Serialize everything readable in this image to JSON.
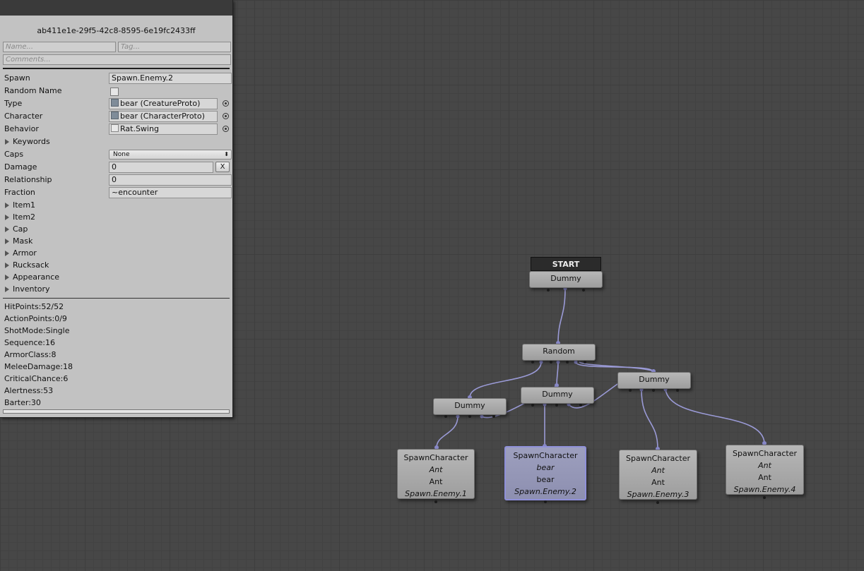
{
  "inspector": {
    "guid": "ab411e1e-29f5-42c8-8595-6e19fc2433ff",
    "name_placeholder": "Name...",
    "tag_placeholder": "Tag...",
    "comments_placeholder": "Comments...",
    "fields": {
      "spawn_label": "Spawn",
      "spawn_value": "Spawn.Enemy.2",
      "random_name_label": "Random Name",
      "type_label": "Type",
      "type_value": "bear (CreatureProto)",
      "character_label": "Character",
      "character_value": "bear (CharacterProto)",
      "behavior_label": "Behavior",
      "behavior_value": "Rat.Swing",
      "keywords_label": "Keywords",
      "caps_label": "Caps",
      "caps_value": "None",
      "damage_label": "Damage",
      "damage_value": "0",
      "clear_label": "X",
      "relationship_label": "Relationship",
      "relationship_value": "0",
      "fraction_label": "Fraction",
      "fraction_value": "~encounter"
    },
    "foldouts": [
      "Item1",
      "Item2",
      "Cap",
      "Mask",
      "Armor",
      "Rucksack",
      "Appearance",
      "Inventory"
    ],
    "stats": [
      "HitPoints:52/52",
      "ActionPoints:0/9",
      "ShotMode:Single",
      "Sequence:16",
      "ArmorClass:8",
      "MeleeDamage:18",
      "CriticalChance:6",
      "Alertness:53",
      "Barter:30"
    ]
  },
  "graph": {
    "start_label": "START",
    "dummy_label": "Dummy",
    "random_label": "Random",
    "spawn_nodes": [
      {
        "title": "SpawnCharacter",
        "type": "Ant",
        "character": "Ant",
        "spawn": "Spawn.Enemy.1"
      },
      {
        "title": "SpawnCharacter",
        "type": "bear",
        "character": "bear",
        "spawn": "Spawn.Enemy.2"
      },
      {
        "title": "SpawnCharacter",
        "type": "Ant",
        "character": "Ant",
        "spawn": "Spawn.Enemy.3"
      },
      {
        "title": "SpawnCharacter",
        "type": "Ant",
        "character": "Ant",
        "spawn": "Spawn.Enemy.4"
      }
    ],
    "colors": {
      "wire": "#9a9ad6",
      "selected_border": "#8f90d9",
      "background": "#474747"
    }
  }
}
